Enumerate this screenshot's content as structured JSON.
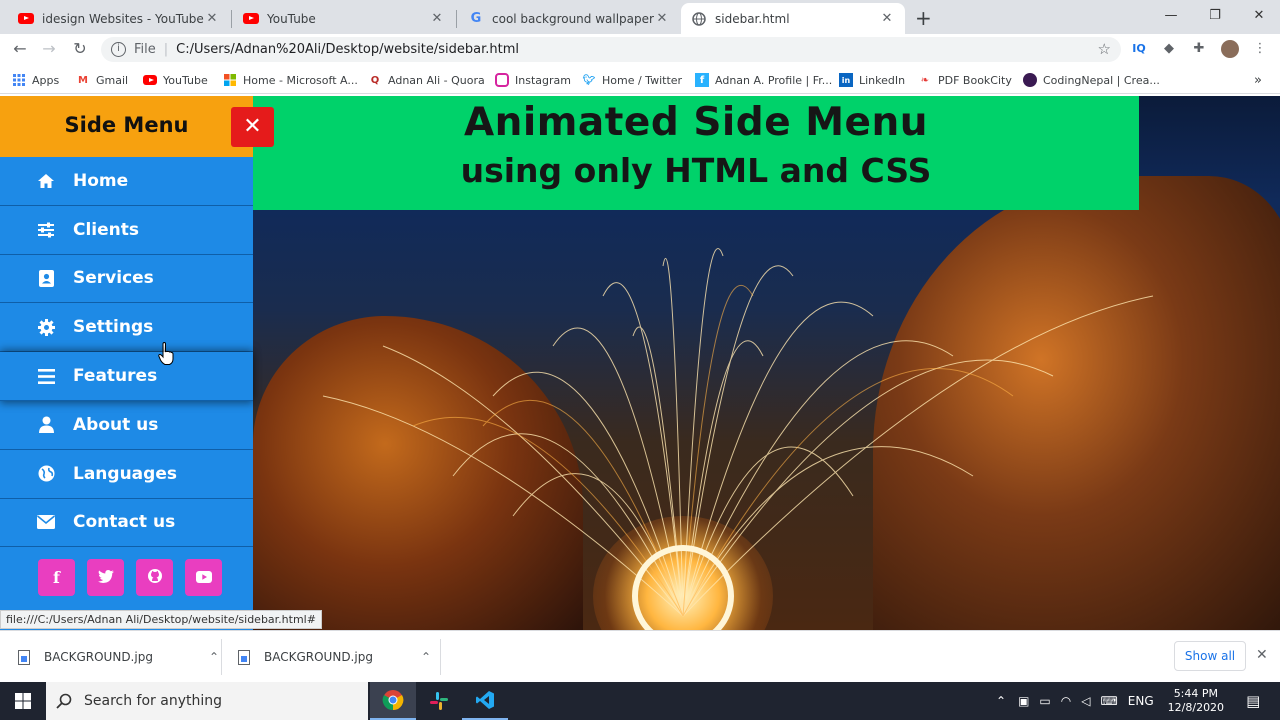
{
  "browser": {
    "tabs": [
      {
        "title": "idesign Websites - YouTube",
        "icon": "youtube-icon"
      },
      {
        "title": "YouTube",
        "icon": "youtube-icon"
      },
      {
        "title": "cool background wallpaper - Goo",
        "icon": "google-icon"
      },
      {
        "title": "sidebar.html",
        "icon": "globe-icon"
      }
    ],
    "address": {
      "scheme_label": "File",
      "url": "C:/Users/Adnan%20Ali/Desktop/website/sidebar.html"
    },
    "bookmarks": [
      {
        "label": "Apps"
      },
      {
        "label": "Gmail"
      },
      {
        "label": "YouTube"
      },
      {
        "label": "Home - Microsoft A..."
      },
      {
        "label": "Adnan Ali - Quora"
      },
      {
        "label": "Instagram"
      },
      {
        "label": "Home / Twitter"
      },
      {
        "label": "Adnan A. Profile | Fr..."
      },
      {
        "label": "LinkedIn"
      },
      {
        "label": "PDF BookCity"
      },
      {
        "label": "CodingNepal | Crea..."
      }
    ],
    "status_url": "file:///C:/Users/Adnan Ali/Desktop/website/sidebar.html#"
  },
  "sidebar": {
    "title": "Side Menu",
    "close_symbol": "✕",
    "items": [
      {
        "label": "Home",
        "icon": "home-icon"
      },
      {
        "label": "Clients",
        "icon": "sliders-icon"
      },
      {
        "label": "Services",
        "icon": "address-card-icon"
      },
      {
        "label": "Settings",
        "icon": "gear-icon"
      },
      {
        "label": "Features",
        "icon": "bars-icon"
      },
      {
        "label": "About us",
        "icon": "user-icon"
      },
      {
        "label": "Languages",
        "icon": "globe-icon"
      },
      {
        "label": "Contact us",
        "icon": "envelope-icon"
      }
    ],
    "social": [
      {
        "glyph": "f",
        "icon": "facebook-icon"
      },
      {
        "glyph": "t",
        "icon": "twitter-icon"
      },
      {
        "glyph": "gh",
        "icon": "github-icon"
      },
      {
        "glyph": "yt",
        "icon": "youtube-icon"
      }
    ]
  },
  "banner": {
    "line1": "Animated Side Menu",
    "line2": "using only HTML and CSS"
  },
  "downloads": {
    "items": [
      {
        "name": "BACKGROUND.jpg"
      },
      {
        "name": "BACKGROUND.jpg"
      }
    ],
    "show_all": "Show all"
  },
  "taskbar": {
    "search_placeholder": "Search for anything",
    "lang": "ENG",
    "time": "5:44 PM",
    "date": "12/8/2020"
  },
  "colors": {
    "sidebar_bg": "#1e8ae6",
    "sidebar_head": "#f7a10f",
    "banner_bg": "#00d26a",
    "close_btn": "#e51b1b",
    "social_btn": "#e93ec0"
  }
}
